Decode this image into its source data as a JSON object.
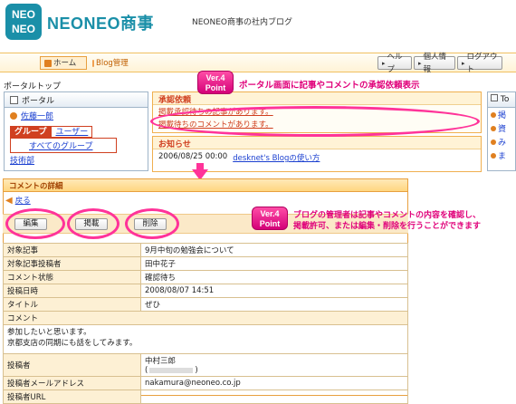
{
  "header": {
    "logo_line1": "NEO",
    "logo_line2": "NEO",
    "company": "NEONEO商事",
    "subtitle": "NEONEO商事の社内ブログ"
  },
  "nav": {
    "home": "ホーム",
    "blog_admin": "Blog管理",
    "help": "ヘルプ",
    "personal": "個人情報",
    "logout": "ログアウト"
  },
  "portal": {
    "top_label": "ポータルトップ",
    "tree_title": "ポータル",
    "user": "佐藤一郎",
    "tab_group": "グループ",
    "tab_user": "ユーザー",
    "all_groups": "すべてのグループ",
    "dept": "技術部",
    "request_title": "承認依頼",
    "request_line1": "掲載承認待ちの記事があります。",
    "request_line2": "掲載待ちのコメントがあります。",
    "news_title": "お知らせ",
    "news_date": "2006/08/25 00:00",
    "news_link": "desknet's Blogの使い方",
    "side_head": "To",
    "side_items": [
      "掲",
      "資",
      "み",
      "ま"
    ]
  },
  "badge1": {
    "line1": "Ver.4",
    "line2": "Point"
  },
  "callout1": "ポータル画面に記事やコメントの承認依頼表示",
  "badge2": {
    "line1": "Ver.4",
    "line2": "Point"
  },
  "callout2_line1": "ブログの管理者は記事やコメントの内容を確認し、",
  "callout2_line2": "掲載許可、または編集・削除を行うことができます",
  "detail": {
    "title": "コメントの詳細",
    "back": "戻る",
    "btn_edit": "編集",
    "btn_publish": "掲載",
    "btn_delete": "削除",
    "rows": [
      {
        "label": "対象記事",
        "value": "9月中旬の勉強会について"
      },
      {
        "label": "対象記事投稿者",
        "value": "田中花子"
      },
      {
        "label": "コメント状態",
        "value": "確認待ち"
      },
      {
        "label": "投稿日時",
        "value": "2008/08/07 14:51"
      },
      {
        "label": "タイトル",
        "value": "ぜひ"
      }
    ],
    "comment_label": "コメント",
    "comment_line1": "参加したいと思います。",
    "comment_line2": "京都支店の同期にも話をしてみます。",
    "poster_label": "投稿者",
    "poster_name": "中村三郎",
    "poster_sub": "(",
    "poster_sub_end": ")",
    "email_label": "投稿者メールアドレス",
    "email_value": "nakamura@neoneo.co.jp",
    "url_label": "投稿者URL",
    "url_value": ""
  }
}
